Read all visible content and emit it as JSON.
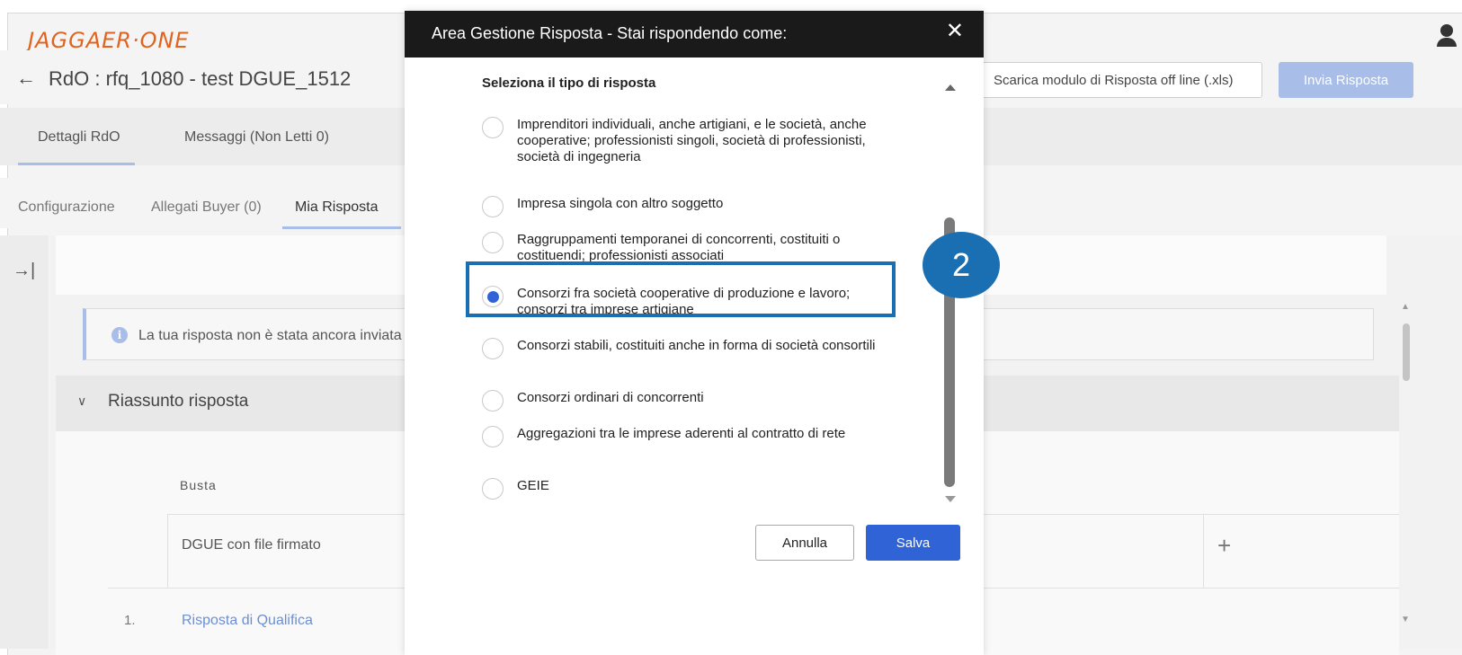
{
  "header": {
    "logo": "JAGGAER·ONE",
    "back_arrow": "←",
    "rdo_title": "RdO : rfq_1080 - test DGUE_1512",
    "offline_button": "Scarica modulo di Risposta off line (.xls)",
    "send_button": "Invia Risposta"
  },
  "tabs_primary": [
    {
      "label": "Dettagli RdO"
    },
    {
      "label": "Messaggi (Non Letti 0)"
    }
  ],
  "tabs_secondary": [
    {
      "label": "Configurazione"
    },
    {
      "label": "Allegati Buyer (0)"
    },
    {
      "label": "Mia Risposta"
    }
  ],
  "side_toggle": "→|",
  "info": {
    "icon": "i",
    "text": "La tua risposta non è stata ancora inviata"
  },
  "summary": {
    "chevron": "∨",
    "label": "Riassunto risposta"
  },
  "table": {
    "header": "Busta",
    "rows": [
      {
        "label": "DGUE con file firmato",
        "action": "+"
      },
      {
        "number": "1.",
        "link": "Risposta di Qualifica"
      }
    ]
  },
  "modal": {
    "title": "Area Gestione Risposta - Stai rispondendo come:",
    "close": "✕",
    "heading": "Seleziona il tipo di risposta",
    "options": [
      {
        "label": "Imprenditori individuali, anche artigiani, e le società, anche cooperative; professionisti singoli, società di professionisti, società di ingegneria",
        "checked": false
      },
      {
        "label": "Impresa singola con altro soggetto",
        "checked": false
      },
      {
        "label": "Raggruppamenti temporanei di concorrenti, costituiti o costituendi; professionisti associati",
        "checked": false
      },
      {
        "label": "Consorzi fra società cooperative di produzione e lavoro; consorzi tra imprese artigiane",
        "checked": true
      },
      {
        "label": "Consorzi stabili, costituiti anche in forma di società consortili",
        "checked": false
      },
      {
        "label": "Consorzi ordinari di concorrenti",
        "checked": false
      },
      {
        "label": "Aggregazioni tra le imprese aderenti al contratto di rete",
        "checked": false
      },
      {
        "label": "GEIE",
        "checked": false
      }
    ],
    "cancel_button": "Annulla",
    "save_button": "Salva"
  },
  "annotation": {
    "step_number": "2"
  },
  "colors": {
    "accent": "#3063d6",
    "annotation": "#1a6fb3",
    "modal_header": "#1a1a1a",
    "logo": "#e0641e"
  }
}
